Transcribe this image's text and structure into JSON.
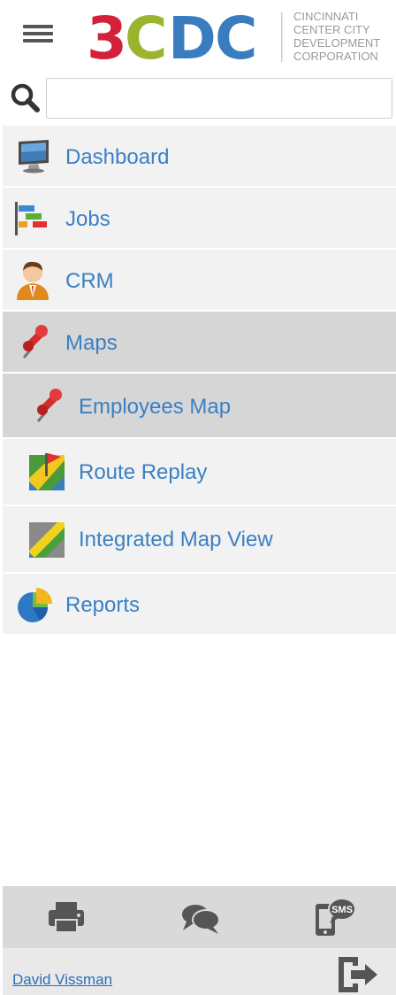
{
  "header": {
    "logo_mark": "3CDC",
    "logo_subtitle_lines": [
      "CINCINNATI",
      "CENTER CITY",
      "DEVELOPMENT",
      "CORPORATION"
    ]
  },
  "search": {
    "value": "",
    "placeholder": ""
  },
  "menu": {
    "items": [
      {
        "label": "Dashboard",
        "icon": "monitor-icon",
        "active": false
      },
      {
        "label": "Jobs",
        "icon": "gantt-chart-icon",
        "active": false
      },
      {
        "label": "CRM",
        "icon": "person-icon",
        "active": false
      },
      {
        "label": "Maps",
        "icon": "pushpin-icon",
        "active": true
      },
      {
        "label": "Employees Map",
        "icon": "pushpin-icon",
        "active": true,
        "submenu": true
      },
      {
        "label": "Route Replay",
        "icon": "map-flag-icon",
        "active": false,
        "submenu": true
      },
      {
        "label": "Integrated Map View",
        "icon": "map-icon",
        "active": false,
        "submenu": true
      },
      {
        "label": "Reports",
        "icon": "pie-chart-icon",
        "active": false
      }
    ]
  },
  "footer": {
    "buttons": [
      {
        "icon": "printer-icon"
      },
      {
        "icon": "chat-bubbles-icon"
      },
      {
        "icon": "sms-phone-icon",
        "badge": "SMS"
      }
    ]
  },
  "user": {
    "name": "David Vissman"
  },
  "colors": {
    "link": "#3a80c4",
    "menu_bg": "#f2f2f2",
    "active_bg": "#d6d6d6",
    "footer_bg": "#d9d9d9",
    "logo_red": "#d3213a",
    "logo_green": "#9bb42e",
    "logo_blue": "#3a7cc0"
  }
}
